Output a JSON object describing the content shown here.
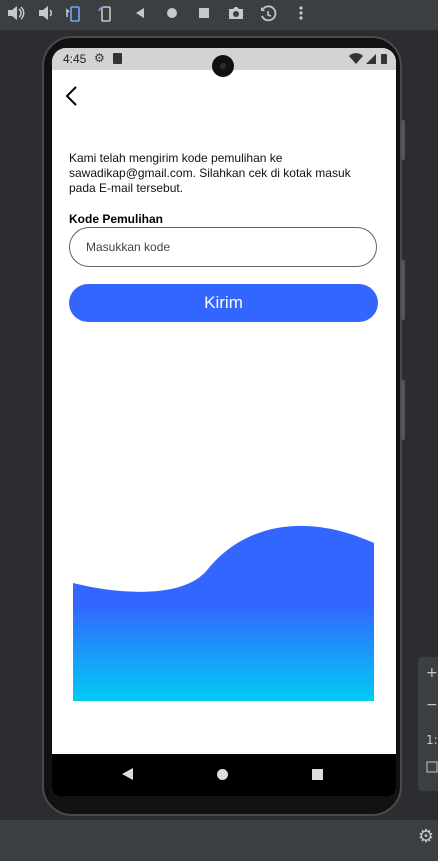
{
  "emulator": {
    "toolbar_icons": [
      "volume-up-icon",
      "volume-down-icon",
      "rotate-left-icon",
      "rotate-right-icon",
      "back-icon",
      "home-icon",
      "overview-icon",
      "camera-icon",
      "replay-icon",
      "more-icon"
    ],
    "side_panel": {
      "plus": "+",
      "minus": "−",
      "ratio": "1:"
    }
  },
  "status_bar": {
    "time": "4:45",
    "icons": [
      "settings-icon",
      "sd-card-icon",
      "wifi-icon",
      "signal-icon",
      "battery-icon"
    ]
  },
  "app": {
    "back_icon": "arrow-left-icon",
    "message": "Kami telah mengirim kode  pemulihan ke sawadikap@gmail.com. Silahkan cek di kotak masuk pada E-mail tersebut.",
    "code_label": "Kode Pemulihan",
    "code_input": {
      "value": "",
      "placeholder": "Masukkan kode"
    },
    "send_button": "Kirim",
    "colors": {
      "primary": "#3366ff",
      "wave_top": "#3366ff",
      "wave_bottom": "#00ccf5"
    }
  },
  "nav_bar": {
    "icons": [
      "nav-back-icon",
      "nav-home-icon",
      "nav-recent-icon"
    ]
  }
}
